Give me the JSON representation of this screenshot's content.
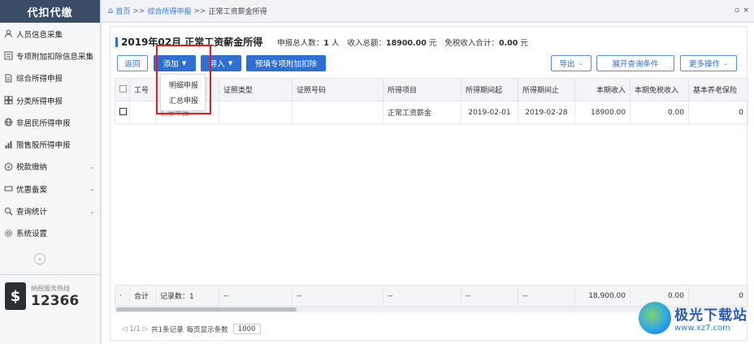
{
  "sidebar": {
    "title": "代扣代缴",
    "items": [
      {
        "label": "人员信息采集",
        "icon": "person-icon",
        "has_chevron": false
      },
      {
        "label": "专项附加扣除信息采集",
        "icon": "list-icon",
        "has_chevron": true
      },
      {
        "label": "综合所得申报",
        "icon": "document-icon",
        "has_chevron": false
      },
      {
        "label": "分类所得申报",
        "icon": "grid-icon",
        "has_chevron": false
      },
      {
        "label": "非居民所得申报",
        "icon": "globe-icon",
        "has_chevron": false
      },
      {
        "label": "限售股所得申报",
        "icon": "chart-icon",
        "has_chevron": false
      },
      {
        "label": "税款缴纳",
        "icon": "coin-icon",
        "has_chevron": true
      },
      {
        "label": "优惠备案",
        "icon": "ticket-icon",
        "has_chevron": true
      },
      {
        "label": "查询统计",
        "icon": "search-icon",
        "has_chevron": true
      },
      {
        "label": "系统设置",
        "icon": "gear-icon",
        "has_chevron": false
      }
    ],
    "collapse_glyph": "«",
    "hotline_label": "纳税服务热线",
    "hotline_number": "12366"
  },
  "breadcrumb": {
    "home": "首页",
    "sep1": ">>",
    "level1": "综合所得申报",
    "sep2": ">>",
    "level2": "正常工资薪金所得"
  },
  "window_controls": {
    "restore": "▫",
    "close": "×"
  },
  "header": {
    "title": "2019年02月  正常工资薪金所得",
    "summary_count_label": "申报总人数：",
    "summary_count_value": "1",
    "summary_count_unit": "人",
    "summary_income_label": "收入总额：",
    "summary_income_value": "18900.00",
    "summary_income_unit": "元",
    "summary_exempt_label": "免税收入合计：",
    "summary_exempt_value": "0.00",
    "summary_exempt_unit": "元"
  },
  "toolbar": {
    "back": "返回",
    "add": "添加",
    "import": "导入",
    "prefill": "预填专项附加扣除",
    "export": "导出",
    "expand_query": "展开查询条件",
    "more_actions": "更多操作"
  },
  "add_menu": {
    "items": [
      "明细申报",
      "汇总申报"
    ]
  },
  "table": {
    "columns": [
      "",
      "工号",
      "",
      "证照类型",
      "证照号码",
      "所得项目",
      "所得期间起",
      "所得期间止",
      "本期收入",
      "本期免税收入",
      "基本养老保险"
    ],
    "rows": [
      [
        "",
        "",
        "汇总申报",
        "",
        "",
        "正常工资薪金",
        "2019-02-01",
        "2019-02-28",
        "18900.00",
        "0.00",
        "0"
      ]
    ],
    "footer": [
      "·",
      "合计",
      "记录数：1",
      "--",
      "--",
      "--",
      "--",
      "--",
      "18,900.00",
      "0.00",
      "0"
    ]
  },
  "pager": {
    "nav": "◁ 1/1 ▷",
    "total": "共1条记录",
    "per_page_label": "每页显示条数",
    "per_page_value": "1000"
  },
  "watermark": {
    "title": "极光下载站",
    "url": "www.xz7.com"
  },
  "colors": {
    "accent": "#2f6fd1",
    "sidebar_header": "#3a4d66",
    "highlight": "#e02020"
  }
}
